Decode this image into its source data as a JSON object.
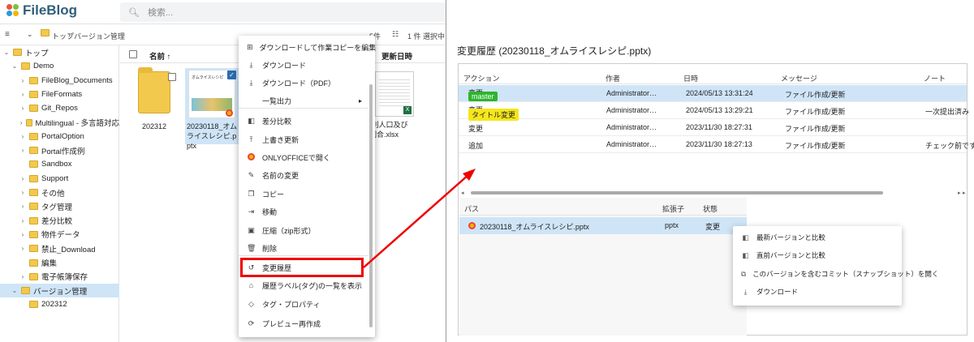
{
  "app": {
    "brand": "FileBlog",
    "search_placeholder": "検索...",
    "breadcrumb": [
      "トップ",
      "バージョン管理"
    ],
    "count": "5件",
    "selection": "1 件 選択中"
  },
  "tree": [
    {
      "label": "トップ",
      "level": 0,
      "expanded": true
    },
    {
      "label": "Demo",
      "level": 1,
      "expanded": true
    },
    {
      "label": "FileBlog_Documents",
      "level": 2
    },
    {
      "label": "FileFormats",
      "level": 2
    },
    {
      "label": "Git_Repos",
      "level": 2
    },
    {
      "label": "Multilingual - 多言語対応",
      "level": 2
    },
    {
      "label": "PortalOption",
      "level": 2
    },
    {
      "label": "Portal作成例",
      "level": 2
    },
    {
      "label": "Sandbox",
      "level": 2,
      "leaf": true
    },
    {
      "label": "Support",
      "level": 2
    },
    {
      "label": "その他",
      "level": 2
    },
    {
      "label": "タグ管理",
      "level": 2
    },
    {
      "label": "差分比較",
      "level": 2
    },
    {
      "label": "物件データ",
      "level": 2
    },
    {
      "label": "禁止_Download",
      "level": 2
    },
    {
      "label": "編集",
      "level": 2,
      "leaf": true
    },
    {
      "label": "電子帳簿保存",
      "level": 2
    },
    {
      "label": "バージョン管理",
      "level": 1,
      "expanded": true,
      "selected": true
    },
    {
      "label": "202312",
      "level": 2,
      "leaf": true
    }
  ],
  "files": {
    "header_name": "名前",
    "header_updated": "更新日時",
    "items": [
      {
        "name": "202312",
        "kind": "folder"
      },
      {
        "name": "20230118_オムライスレシピ.pptx",
        "kind": "pptx",
        "thumb_title": "オムライスレシピ"
      },
      {
        "name": "t別人口及び\n割合.xlsx",
        "kind": "xlsx"
      }
    ]
  },
  "context_menu": [
    {
      "label": "ダウンロードして作業コピーを編集",
      "icon": "windows-icon"
    },
    {
      "label": "ダウンロード",
      "icon": "download-icon"
    },
    {
      "label": "ダウンロード（PDF）",
      "icon": "download-icon"
    },
    {
      "label": "一覧出力",
      "icon": "",
      "submenu": true
    },
    {
      "label": "差分比較",
      "icon": "compare-icon"
    },
    {
      "label": "上書き更新",
      "icon": "upload-icon"
    },
    {
      "label": "ONLYOFFICEで開く",
      "icon": "onlyoffice-icon"
    },
    {
      "label": "名前の変更",
      "icon": "pencil-icon"
    },
    {
      "label": "コピー",
      "icon": "copy-icon"
    },
    {
      "label": "移動",
      "icon": "move-icon"
    },
    {
      "label": "圧縮（zip形式）",
      "icon": "zip-icon"
    },
    {
      "label": "削除",
      "icon": "trash-icon"
    },
    {
      "label": "変更履歴",
      "icon": "history-icon"
    },
    {
      "label": "履歴ラベル(タグ)の一覧を表示",
      "icon": "label-icon"
    },
    {
      "label": "タグ・プロパティ",
      "icon": "tag-icon"
    },
    {
      "label": "プレビュー再作成",
      "icon": "refresh-icon"
    }
  ],
  "history": {
    "title": "変更履歴 (20230118_オムライスレシピ.pptx)",
    "columns": [
      "アクション",
      "作者",
      "日時",
      "メッセージ",
      "ノート"
    ],
    "rows": [
      {
        "tag": "master",
        "tag_color": "#2db52d",
        "action": "変更",
        "author": "Administrator…",
        "date": "2024/05/13 13:31:24",
        "message": "ファイル作成/更新",
        "note": "",
        "selected": true
      },
      {
        "tag": "タイトル変更",
        "tag_color": "#f5e61b",
        "action": "変更",
        "author": "Administrator…",
        "date": "2024/05/13 13:29:21",
        "message": "ファイル作成/更新",
        "note": "一次提出済み"
      },
      {
        "tag": "",
        "action": "変更",
        "author": "Administrator…",
        "date": "2023/11/30 18:27:31",
        "message": "ファイル作成/更新",
        "note": ""
      },
      {
        "tag": "",
        "action": "追加",
        "author": "Administrator…",
        "date": "2023/11/30 18:27:13",
        "message": "ファイル作成/更新",
        "note": "チェック前です"
      }
    ],
    "lower_columns": [
      "パス",
      "拡張子",
      "状態"
    ],
    "lower_row": {
      "path": "20230118_オムライスレシピ.pptx",
      "ext": "pptx",
      "state": "変更"
    }
  },
  "history_menu": [
    {
      "label": "最新バージョンと比較",
      "icon": "compare-icon"
    },
    {
      "label": "直前バージョンと比較",
      "icon": "compare-icon"
    },
    {
      "label": "このバージョンを含むコミット（スナップショット）を開く",
      "icon": "open-external-icon"
    },
    {
      "label": "ダウンロード",
      "icon": "download-icon"
    }
  ],
  "colors": {
    "accent": "#e00000",
    "selection": "#cfe5f7",
    "brand": "#2f5f7a"
  }
}
